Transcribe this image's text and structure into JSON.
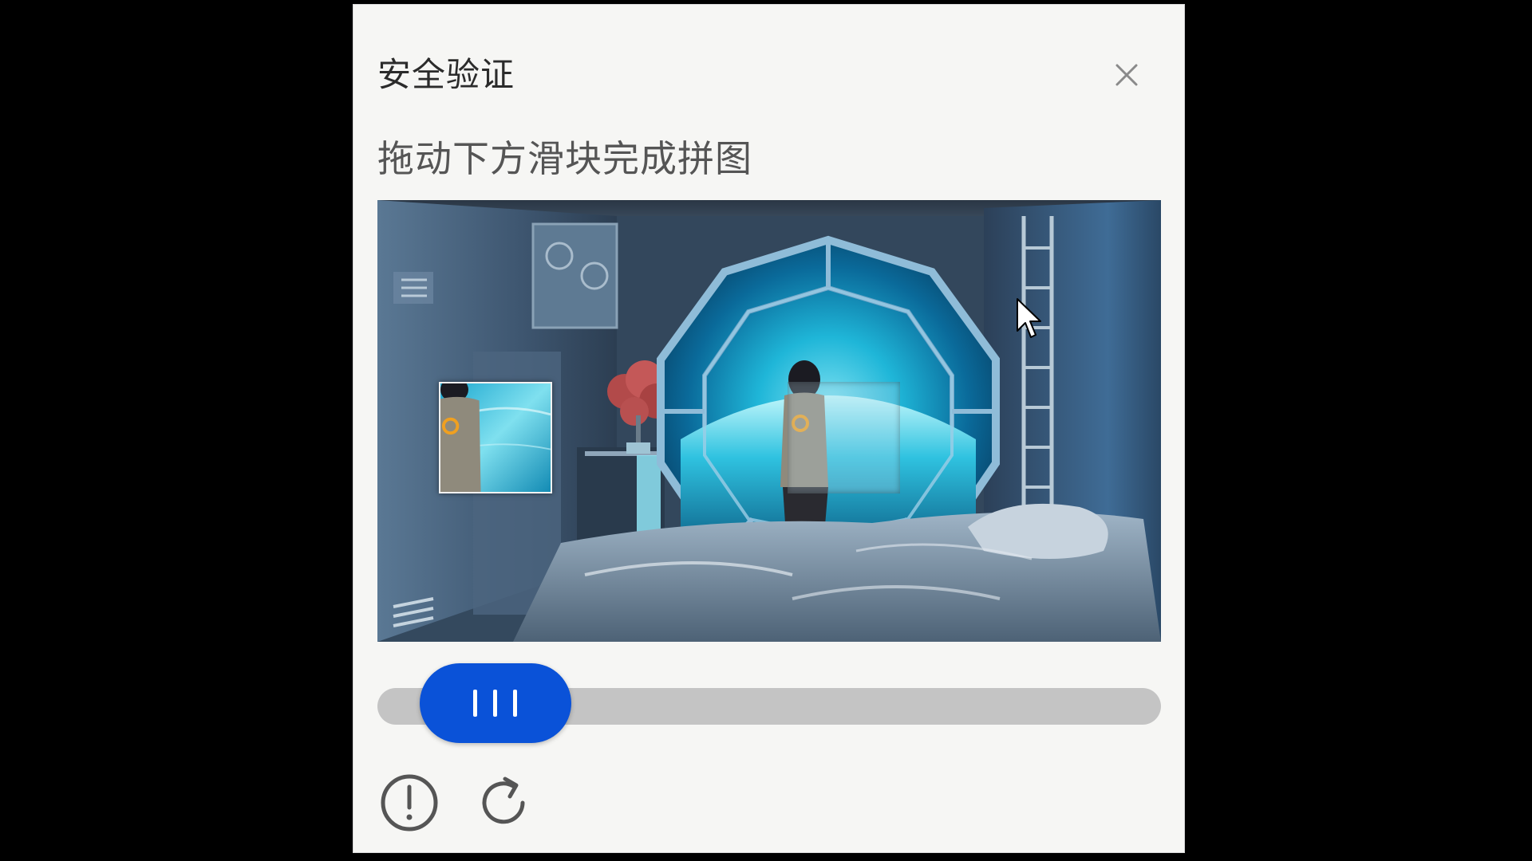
{
  "dialog": {
    "title": "安全验证",
    "hint": "拖动下方滑块完成拼图"
  },
  "icons": {
    "close": "close-icon",
    "feedback": "exclamation-circle-icon",
    "refresh": "refresh-icon",
    "grip": "grip-lines-icon",
    "cursor": "mouse-pointer-icon"
  },
  "slider": {
    "progress": 0.06
  },
  "colors": {
    "accent": "#0a52d8",
    "track": "#c4c4c4",
    "dialog_bg": "#f6f6f4",
    "backdrop": "#000000"
  }
}
